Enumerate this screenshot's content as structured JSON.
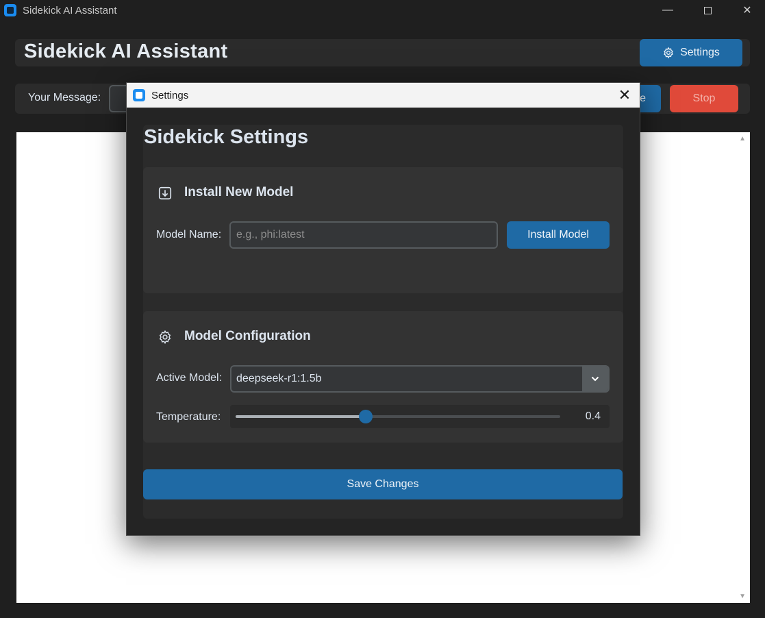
{
  "window": {
    "title": "Sidekick AI Assistant",
    "minimize_glyph": "—",
    "close_glyph": "✕"
  },
  "header": {
    "title": "Sidekick AI Assistant",
    "settings_label": "Settings"
  },
  "message_bar": {
    "label": "Your Message:",
    "send_label": "Send",
    "send_visible": "e",
    "stop_label": "Stop"
  },
  "dialog": {
    "title": "Settings",
    "close_glyph": "✕",
    "heading": "Sidekick Settings",
    "install": {
      "title": "Install New Model",
      "icon": "download-icon",
      "model_name_label": "Model Name:",
      "model_name_value": "",
      "model_name_placeholder": "e.g., phi:latest",
      "install_label": "Install Model"
    },
    "config": {
      "title": "Model Configuration",
      "icon": "gear-icon",
      "active_model_label": "Active Model:",
      "active_model_value": "deepseek-r1:1.5b",
      "temperature_label": "Temperature:",
      "temperature_value": "0.4",
      "temperature_fraction": 0.4
    },
    "save_label": "Save Changes"
  },
  "colors": {
    "accent": "#1f6aa5",
    "stop": "#e04a3a",
    "background": "#242424",
    "panel": "#333333"
  }
}
